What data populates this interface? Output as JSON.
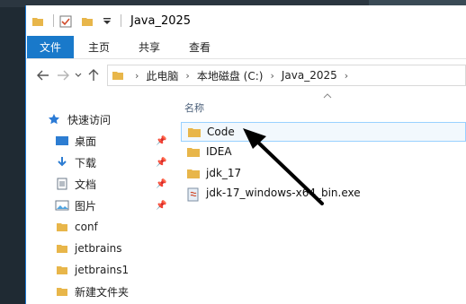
{
  "window": {
    "title": "Java_2025"
  },
  "ribbon": {
    "tabs": [
      "文件",
      "主页",
      "共享",
      "查看"
    ]
  },
  "address": {
    "crumbs": [
      "此电脑",
      "本地磁盘 (C:)",
      "Java_2025"
    ]
  },
  "nav_pane": {
    "quick_access_label": "快速访问",
    "items": [
      {
        "label": "桌面",
        "icon": "desktop-icon",
        "pinned": true
      },
      {
        "label": "下载",
        "icon": "download-icon",
        "pinned": true
      },
      {
        "label": "文档",
        "icon": "documents-icon",
        "pinned": true
      },
      {
        "label": "图片",
        "icon": "pictures-icon",
        "pinned": true
      },
      {
        "label": "conf",
        "icon": "folder-icon",
        "pinned": false
      },
      {
        "label": "jetbrains",
        "icon": "folder-icon",
        "pinned": false
      },
      {
        "label": "jetbrains1",
        "icon": "folder-icon",
        "pinned": false
      },
      {
        "label": "新建文件夹",
        "icon": "folder-icon",
        "pinned": false
      }
    ]
  },
  "file_list": {
    "column_header": "名称",
    "items": [
      {
        "name": "Code",
        "type": "folder",
        "selected": true
      },
      {
        "name": "IDEA",
        "type": "folder",
        "selected": false
      },
      {
        "name": "jdk_17",
        "type": "folder",
        "selected": false
      },
      {
        "name": "jdk-17_windows-x64_bin.exe",
        "type": "installer",
        "selected": false
      }
    ]
  },
  "colors": {
    "accent": "#1979ca",
    "folder": "#e8b64a",
    "selection_border": "#99d1ff",
    "annotation_arrow": "#000000"
  }
}
